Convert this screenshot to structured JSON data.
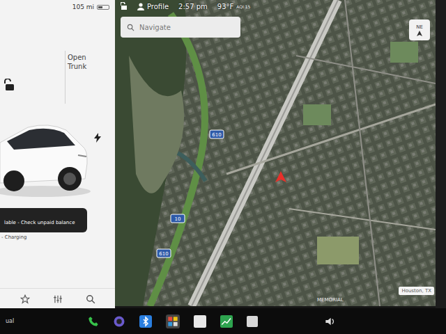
{
  "status": {
    "range": "105 mi",
    "profile": "Profile",
    "time": "2:57 pm",
    "temperature": "93°F",
    "aqi": "AQI 15"
  },
  "search": {
    "placeholder": "Navigate"
  },
  "car": {
    "trunk_label": "Open Trunk",
    "locked": false,
    "charging": true
  },
  "notice": {
    "text": "lable - Check unpaid balance",
    "sub": "- Charging"
  },
  "map": {
    "compass": "NE",
    "shields": [
      "610",
      "10",
      "610"
    ],
    "labels": [
      "MEMORIAL",
      "Houston, TX"
    ]
  },
  "dock": {
    "left_label": "ual"
  }
}
